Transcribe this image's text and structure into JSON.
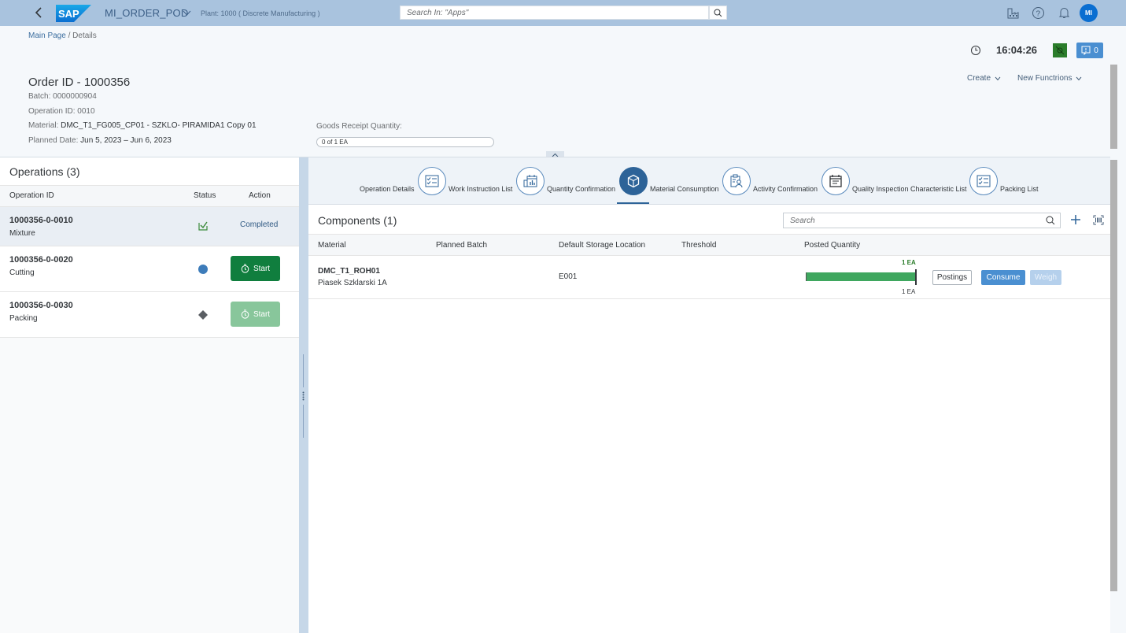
{
  "shell": {
    "app_title": "MI_ORDER_POD",
    "plant": "Plant: 1000 ( Discrete Manufacturing )",
    "search_placeholder": "Search In: \"Apps\"",
    "avatar_initials": "MI",
    "icons": [
      "back-icon",
      "sap-logo",
      "chevron-down-icon",
      "search-icon",
      "factory-icon",
      "help-icon",
      "bell-icon"
    ]
  },
  "breadcrumb": {
    "link": "Main Page",
    "separator": " / ",
    "current": "Details"
  },
  "header": {
    "time": "16:04:26",
    "notification_count": "0",
    "menus": [
      "Create",
      "New Functrions"
    ],
    "order_title": "Order ID - 1000356",
    "attributes": [
      {
        "label": "Batch: ",
        "value": "0000000904"
      },
      {
        "label": "Operation ID: ",
        "value": "0010"
      },
      {
        "label": "Material: ",
        "value": "DMC_T1_FG005_CP01 - SZKLO- PIRAMIDA1 Copy 01"
      },
      {
        "label": "Planned Date: ",
        "value": "Jun 5, 2023 – Jun 6, 2023"
      }
    ],
    "goods_receipt_label": "Goods Receipt Quantity:",
    "goods_receipt_value": "0 of 1 EA"
  },
  "operations": {
    "title": "Operations (3)",
    "columns": [
      "Operation ID",
      "Status",
      "Action"
    ],
    "rows": [
      {
        "id": "1000356-0-0010",
        "desc": "Mixture",
        "status": "completed",
        "action": "Completed"
      },
      {
        "id": "1000356-0-0020",
        "desc": "Cutting",
        "status": "active",
        "action": "Start"
      },
      {
        "id": "1000356-0-0030",
        "desc": "Packing",
        "status": "not-started",
        "action": "Start"
      }
    ]
  },
  "tabs": [
    {
      "label": "Operation Details",
      "icon": "checklist-icon"
    },
    {
      "label": "Work Instruction List",
      "icon": "calendar-chart-icon"
    },
    {
      "label": "Quantity Confirmation",
      "icon": "cube-icon",
      "active": true
    },
    {
      "label": "Material Consumption",
      "icon": "clipboard-person-icon"
    },
    {
      "label": "Activity Confirmation",
      "icon": "calendar-list-icon"
    },
    {
      "label": "Quality Inspection Characteristic List",
      "icon": "checklist-icon"
    },
    {
      "label": "Packing List"
    }
  ],
  "components": {
    "title": "Components (1)",
    "search_placeholder": "Search",
    "columns": [
      "Material",
      "Planned Batch",
      "Default Storage Location",
      "Threshold",
      "Posted Quantity"
    ],
    "rows": [
      {
        "material": "DMC_T1_ROH01",
        "description": "Piasek Szklarski 1A",
        "planned_batch": "",
        "storage_location": "E001",
        "threshold": "",
        "posted_qty": "1 EA",
        "required_qty": "1 EA",
        "posted_fraction": 1.0,
        "buttons": [
          "Postings",
          "Consume",
          "Weigh"
        ]
      }
    ]
  },
  "colors": {
    "shell": "#a9c3de",
    "accent": "#2d6398",
    "start_green": "#107e3e",
    "progress_green": "#3fa75f",
    "consume_blue": "#4a8fd1"
  }
}
